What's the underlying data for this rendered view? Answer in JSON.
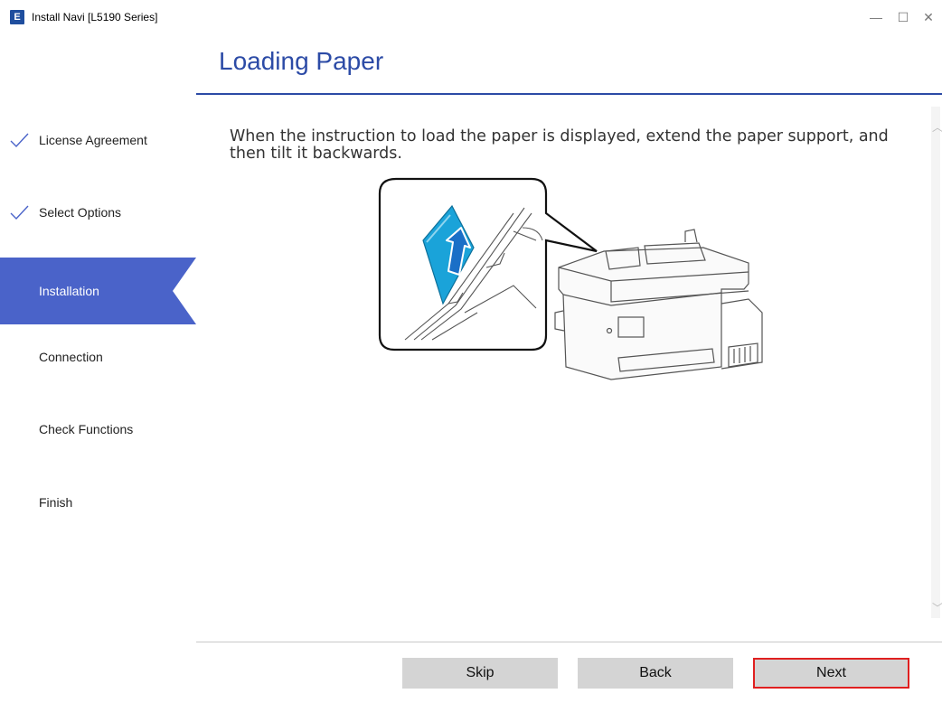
{
  "window": {
    "title": "Install Navi [L5190 Series]",
    "app_icon_letter": "E",
    "minimize_glyph": "—",
    "maximize_glyph": "☐",
    "close_glyph": "✕"
  },
  "sidebar": {
    "steps": [
      {
        "label": "License Agreement",
        "state": "done"
      },
      {
        "label": "Select Options",
        "state": "done"
      },
      {
        "label": "Installation",
        "state": "active"
      },
      {
        "label": "Connection",
        "state": "pending"
      },
      {
        "label": "Check Functions",
        "state": "pending"
      },
      {
        "label": "Finish",
        "state": "pending"
      }
    ]
  },
  "main": {
    "title": "Loading Paper",
    "instruction": "When the instruction to load the paper is displayed, extend the paper support, and then tilt it backwards."
  },
  "buttons": {
    "skip": "Skip",
    "back": "Back",
    "next": "Next"
  },
  "colors": {
    "accent": "#2c4ba6",
    "active_step": "#4a63c9",
    "highlight_border": "#e02020",
    "paper_blue": "#1aa3d9"
  }
}
